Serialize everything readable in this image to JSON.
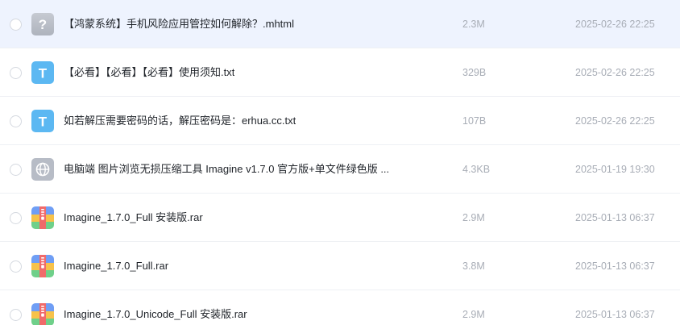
{
  "files": [
    {
      "name": "【鸿蒙系统】手机风险应用管控如何解除？.mhtml",
      "size": "2.3M",
      "date": "2025-02-26 22:25",
      "icon": "unknown-file-icon",
      "selected": true
    },
    {
      "name": "【必看】【必看】【必看】使用须知.txt",
      "size": "329B",
      "date": "2025-02-26 22:25",
      "icon": "text-file-icon",
      "selected": false
    },
    {
      "name": "如若解压需要密码的话，解压密码是：erhua.cc.txt",
      "size": "107B",
      "date": "2025-02-26 22:25",
      "icon": "text-file-icon",
      "selected": false
    },
    {
      "name": "电脑端 图片浏览无损压缩工具 Imagine v1.7.0 官方版+单文件绿色版 ...",
      "size": "4.3KB",
      "date": "2025-01-19 19:30",
      "icon": "web-file-icon",
      "selected": false
    },
    {
      "name": "Imagine_1.7.0_Full 安装版.rar",
      "size": "2.9M",
      "date": "2025-01-13 06:37",
      "icon": "archive-file-icon",
      "selected": false
    },
    {
      "name": "Imagine_1.7.0_Full.rar",
      "size": "3.8M",
      "date": "2025-01-13 06:37",
      "icon": "archive-file-icon",
      "selected": false
    },
    {
      "name": "Imagine_1.7.0_Unicode_Full 安装版.rar",
      "size": "2.9M",
      "date": "2025-01-13 06:37",
      "icon": "archive-file-icon",
      "selected": false
    }
  ],
  "colors": {
    "selected_row": "#eef3fe",
    "text_icon": "#5cb8f2",
    "unknown_icon": "#b9bec8",
    "web_icon": "#b7bcc6"
  }
}
